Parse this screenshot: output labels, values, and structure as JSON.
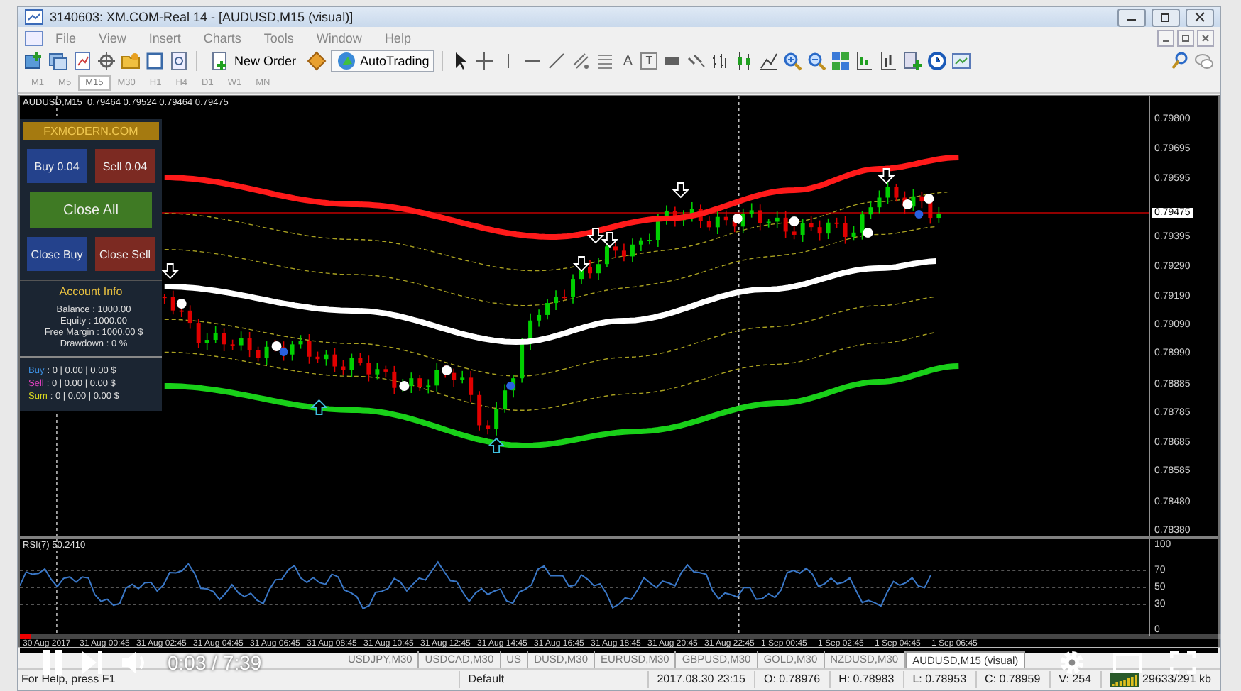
{
  "window": {
    "title": "3140603: XM.COM-Real 14 - [AUDUSD,M15 (visual)]"
  },
  "menu": [
    "File",
    "View",
    "Insert",
    "Charts",
    "Tools",
    "Window",
    "Help"
  ],
  "toolbar": {
    "buttons": [
      {
        "label": "New Order",
        "selected": false
      },
      {
        "label": "AutoTrading",
        "selected": true
      }
    ],
    "text_tools": [
      "A",
      "T"
    ]
  },
  "timeframes": [
    {
      "label": "M1",
      "selected": false
    },
    {
      "label": "M5",
      "selected": false
    },
    {
      "label": "M15",
      "selected": true
    },
    {
      "label": "M30",
      "selected": false
    },
    {
      "label": "H1",
      "selected": false
    },
    {
      "label": "H4",
      "selected": false
    },
    {
      "label": "D1",
      "selected": false
    },
    {
      "label": "W1",
      "selected": false
    },
    {
      "label": "MN",
      "selected": false
    }
  ],
  "chart": {
    "title": "AUDUSD,M15  0.79464 0.79524 0.79464 0.79475",
    "price_ticks": [
      "0.79800",
      "0.79695",
      "0.79595",
      "0.79395",
      "0.79290",
      "0.79190",
      "0.79090",
      "0.78990",
      "0.78885",
      "0.78785",
      "0.78685",
      "0.78585",
      "0.78480",
      "0.78380"
    ],
    "current_price": "0.79475",
    "panel": {
      "brand": "FXMODERN.COM",
      "buttons": [
        {
          "label": "Buy 0.04",
          "kind": "half",
          "color": "#24428c"
        },
        {
          "label": "Sell 0.04",
          "kind": "half",
          "color": "#7c2a22"
        },
        {
          "label": "Close All",
          "kind": "wide",
          "color": "#3f7a24"
        },
        {
          "label": "Close Buy",
          "kind": "half",
          "color": "#24428c"
        },
        {
          "label": "Close Sell",
          "kind": "half",
          "color": "#7c2a22"
        }
      ],
      "account_title": "Account Info",
      "account_rows": [
        "Balance : 1000.00",
        "Equity : 1000.00",
        "Free Margin : 1000.00 $",
        "Drawdown : 0 %"
      ],
      "position_rows": [
        {
          "label": "Buy",
          "value": ": 0 | 0.00 | 0.00 $",
          "color": "#3d8fe0"
        },
        {
          "label": "Sell",
          "value": ": 0 | 0.00 | 0.00 $",
          "color": "#e040c0"
        },
        {
          "label": "Sum",
          "value": ": 0 | 0.00 | 0.00 $",
          "color": "#d8d820"
        }
      ]
    },
    "indicator": {
      "title": "RSI(7) 50.2410",
      "ticks": [
        "100",
        "70",
        "50",
        "30",
        "0"
      ]
    },
    "time_labels": [
      "30 Aug 2017",
      "31 Aug 00:45",
      "31 Aug 02:45",
      "31 Aug 04:45",
      "31 Aug 06:45",
      "31 Aug 08:45",
      "31 Aug 10:45",
      "31 Aug 12:45",
      "31 Aug 14:45",
      "31 Aug 16:45",
      "31 Aug 18:45",
      "31 Aug 20:45",
      "31 Aug 22:45",
      "1 Sep 00:45",
      "1 Sep 02:45",
      "1 Sep 04:45",
      "1 Sep 06:45"
    ]
  },
  "tabs": [
    {
      "label": "USDJPY,M30",
      "selected": false
    },
    {
      "label": "USDCAD,M30",
      "selected": false
    },
    {
      "label": "US",
      "selected": false
    },
    {
      "label": "DUSD,M30",
      "selected": false
    },
    {
      "label": "EURUSD,M30",
      "selected": false
    },
    {
      "label": "GBPUSD,M30",
      "selected": false
    },
    {
      "label": "GOLD,M30",
      "selected": false
    },
    {
      "label": "NZDUSD,M30",
      "selected": false
    },
    {
      "label": "AUDUSD,M15 (visual)",
      "selected": true
    }
  ],
  "status_bar": [
    "For Help, press F1",
    "Default",
    "2017.08.30 23:15",
    "O: 0.78976",
    "H: 0.78983",
    "L: 0.78953",
    "C: 0.78959",
    "V: 254",
    "29633/291 kb"
  ],
  "video": {
    "time": "0:03 / 7:39",
    "level": 0.01
  }
}
